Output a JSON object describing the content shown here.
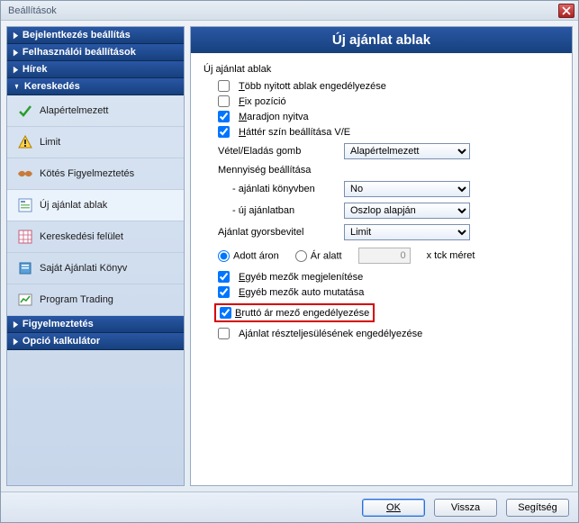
{
  "window": {
    "title": "Beállítások"
  },
  "sidebar": {
    "sections": [
      {
        "label": "Bejelentkezés beállítás"
      },
      {
        "label": "Felhasználói beállítások"
      },
      {
        "label": "Hírek"
      },
      {
        "label": "Kereskedés"
      },
      {
        "label": "Figyelmeztetés"
      },
      {
        "label": "Opció kalkulátor"
      }
    ],
    "items": [
      {
        "label": "Alapértelmezett"
      },
      {
        "label": "Limit"
      },
      {
        "label": "Kötés Figyelmeztetés"
      },
      {
        "label": "Új ajánlat ablak"
      },
      {
        "label": "Kereskedési felület"
      },
      {
        "label": "Saját Ajánlati Könyv"
      },
      {
        "label": "Program Trading"
      }
    ]
  },
  "content": {
    "title": "Új ajánlat ablak",
    "group": "Új ajánlat ablak",
    "cb_multi": "Több nyitott ablak engedélyezése",
    "cb_fix": "Fix pozíció",
    "cb_stayopen": "Maradjon nyitva",
    "cb_bgcolor": "Háttér szín beállítása V/E",
    "lbl_buysell": "Vétel/Eladás gomb",
    "sel_buysell": "Alapértelmezett",
    "lbl_qty": "Mennyiség beállítása",
    "lbl_qbook": "- ajánlati könyvben",
    "sel_qbook": "No",
    "lbl_qnew": "- új ajánlatban",
    "sel_qnew": "Oszlop alapján",
    "lbl_quick": "Ajánlat gyorsbevitel",
    "sel_quick": "Limit",
    "radio_at": "Adott áron",
    "radio_below": "Ár alatt",
    "num_tick": "0",
    "lbl_tick": "x tck méret",
    "cb_showother": "Egyéb mezők megjelenítése",
    "cb_autoother": "Egyéb mezők auto mutatása",
    "cb_gross": "Bruttó ár mező engedélyezése",
    "cb_partial": "Ajánlat részteljesülésének engedélyezése"
  },
  "buttons": {
    "ok": "OK",
    "back": "Vissza",
    "help": "Segítség"
  }
}
